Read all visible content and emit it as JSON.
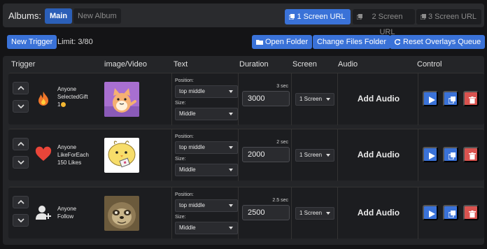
{
  "albums": {
    "label": "Albums:",
    "tabs": [
      "Main",
      "New Album"
    ],
    "screen_urls": [
      "1 Screen URL",
      "2 Screen URL",
      "3 Screen URL"
    ]
  },
  "toolbar": {
    "new_trigger": "New Trigger",
    "limit": "Limit: 3/80",
    "open_folder": "Open Folder",
    "change_files_folder": "Change Files Folder",
    "reset_queue": "Reset Overlays Queue"
  },
  "columns": [
    "Trigger",
    "image/Video",
    "Text",
    "Duration",
    "Screen",
    "Audio",
    "Control"
  ],
  "labels": {
    "position": "Position:",
    "size": "Size:",
    "add_audio": "Add Audio"
  },
  "triggers": [
    {
      "line1": "Anyone",
      "line2": "SelectedGift",
      "line3": "1",
      "icon": "fire-icon",
      "position": "top middle",
      "size": "Middle",
      "duration_label": "3 sec",
      "duration": "3000",
      "screen": "1 Screen"
    },
    {
      "line1": "Anyone",
      "line2": "LikeForEach",
      "line3": "150 Likes",
      "icon": "heart-icon",
      "position": "top middle",
      "size": "Middle",
      "duration_label": "2 sec",
      "duration": "2000",
      "screen": "1 Screen"
    },
    {
      "line1": "Anyone",
      "line2": "Follow",
      "line3": "",
      "icon": "add-user-icon",
      "position": "top middle",
      "size": "Middle",
      "duration_label": "2.5 sec",
      "duration": "2500",
      "screen": "1 Screen"
    }
  ],
  "colors": {
    "accent": "#3a72d8",
    "danger": "#d9534f",
    "background": "#141416",
    "panel": "#242528"
  }
}
